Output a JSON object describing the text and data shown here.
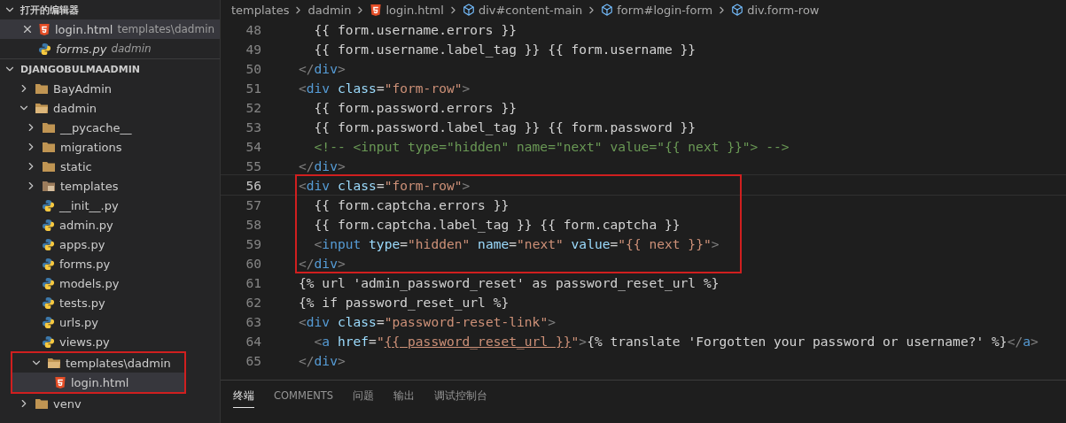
{
  "sidebar": {
    "open_editors": {
      "title": "打开的编辑器",
      "expanded": true,
      "items": [
        {
          "name": "login.html",
          "description": "templates\\dadmin",
          "kind": "html",
          "active": true,
          "preview": false
        },
        {
          "name": "forms.py",
          "description": "dadmin",
          "kind": "python",
          "active": false,
          "preview": true
        }
      ]
    },
    "project": {
      "title": "DJANGOBULMAADMIN",
      "expanded": true,
      "children": [
        {
          "name": "BayAdmin",
          "kind": "folder",
          "expanded": false,
          "selected": false
        },
        {
          "name": "dadmin",
          "kind": "folder",
          "expanded": true,
          "selected": false,
          "children": [
            {
              "name": "__pycache__",
              "kind": "folder",
              "expanded": false,
              "selected": false
            },
            {
              "name": "migrations",
              "kind": "folder",
              "expanded": false,
              "selected": false
            },
            {
              "name": "static",
              "kind": "folder",
              "expanded": false,
              "selected": false
            },
            {
              "name": "templates",
              "kind": "templates-folder",
              "expanded": false,
              "selected": false
            },
            {
              "name": "__init__.py",
              "kind": "python",
              "selected": false
            },
            {
              "name": "admin.py",
              "kind": "python",
              "selected": false
            },
            {
              "name": "apps.py",
              "kind": "python",
              "selected": false
            },
            {
              "name": "forms.py",
              "kind": "python",
              "selected": false
            },
            {
              "name": "models.py",
              "kind": "python",
              "selected": false
            },
            {
              "name": "tests.py",
              "kind": "python",
              "selected": false
            },
            {
              "name": "urls.py",
              "kind": "python",
              "selected": false
            },
            {
              "name": "views.py",
              "kind": "python",
              "selected": false
            }
          ]
        },
        {
          "name": "templates\\dadmin",
          "kind": "folder",
          "expanded": true,
          "selected": false,
          "highlighted": true,
          "children": [
            {
              "name": "login.html",
              "kind": "html",
              "selected": true
            }
          ]
        },
        {
          "name": "venv",
          "kind": "folder",
          "expanded": false,
          "selected": false
        }
      ]
    }
  },
  "breadcrumb": [
    {
      "text": "templates",
      "kind": "folder"
    },
    {
      "text": "dadmin",
      "kind": "folder"
    },
    {
      "text": "login.html",
      "kind": "html"
    },
    {
      "text": "div#content-main",
      "kind": "element"
    },
    {
      "text": "form#login-form",
      "kind": "element"
    },
    {
      "text": "div.form-row",
      "kind": "element"
    }
  ],
  "editor": {
    "lines": [
      {
        "number": "48",
        "current": false,
        "highlighted": false,
        "tokens": [
          {
            "kind": "text",
            "text": "  {{ form.username.errors }}"
          }
        ]
      },
      {
        "number": "49",
        "current": false,
        "highlighted": false,
        "tokens": [
          {
            "kind": "text",
            "text": "  {{ form.username.label_tag }} {{ form.username }}"
          }
        ]
      },
      {
        "number": "50",
        "current": false,
        "highlighted": false,
        "tokens": [
          {
            "kind": "punct",
            "text": "</"
          },
          {
            "kind": "tag",
            "text": "div"
          },
          {
            "kind": "punct",
            "text": ">"
          }
        ]
      },
      {
        "number": "51",
        "current": false,
        "highlighted": false,
        "tokens": [
          {
            "kind": "punct",
            "text": "<"
          },
          {
            "kind": "tag",
            "text": "div"
          },
          {
            "kind": "attr",
            "text": " class"
          },
          {
            "kind": "text",
            "text": "="
          },
          {
            "kind": "str",
            "text": "\"form-row\""
          },
          {
            "kind": "punct",
            "text": ">"
          }
        ]
      },
      {
        "number": "52",
        "current": false,
        "highlighted": false,
        "tokens": [
          {
            "kind": "text",
            "text": "  {{ form.password.errors }}"
          }
        ]
      },
      {
        "number": "53",
        "current": false,
        "highlighted": false,
        "tokens": [
          {
            "kind": "text",
            "text": "  {{ form.password.label_tag }} {{ form.password }}"
          }
        ]
      },
      {
        "number": "54",
        "current": false,
        "highlighted": false,
        "tokens": [
          {
            "kind": "comment",
            "text": "  <!-- <input type=\"hidden\" name=\"next\" value=\"{{ next }}\"> -->"
          }
        ]
      },
      {
        "number": "55",
        "current": false,
        "highlighted": false,
        "tokens": [
          {
            "kind": "punct",
            "text": "</"
          },
          {
            "kind": "tag",
            "text": "div"
          },
          {
            "kind": "punct",
            "text": ">"
          }
        ]
      },
      {
        "number": "56",
        "current": true,
        "highlighted": true,
        "tokens": [
          {
            "kind": "punct",
            "text": "<"
          },
          {
            "kind": "tag",
            "text": "div"
          },
          {
            "kind": "attr",
            "text": " class"
          },
          {
            "kind": "text",
            "text": "="
          },
          {
            "kind": "str",
            "text": "\"form-row\""
          },
          {
            "kind": "punct",
            "text": ">"
          }
        ]
      },
      {
        "number": "57",
        "current": false,
        "highlighted": true,
        "tokens": [
          {
            "kind": "text",
            "text": "  {{ form.captcha.errors }}"
          }
        ]
      },
      {
        "number": "58",
        "current": false,
        "highlighted": true,
        "tokens": [
          {
            "kind": "text",
            "text": "  {{ form.captcha.label_tag }} {{ form.captcha }}"
          }
        ]
      },
      {
        "number": "59",
        "current": false,
        "highlighted": true,
        "tokens": [
          {
            "kind": "punct",
            "text": "  <"
          },
          {
            "kind": "tag",
            "text": "input"
          },
          {
            "kind": "attr",
            "text": " type"
          },
          {
            "kind": "text",
            "text": "="
          },
          {
            "kind": "str",
            "text": "\"hidden\""
          },
          {
            "kind": "attr",
            "text": " name"
          },
          {
            "kind": "text",
            "text": "="
          },
          {
            "kind": "str",
            "text": "\"next\""
          },
          {
            "kind": "attr",
            "text": " value"
          },
          {
            "kind": "text",
            "text": "="
          },
          {
            "kind": "str",
            "text": "\"{{ next }}\""
          },
          {
            "kind": "punct",
            "text": ">"
          }
        ]
      },
      {
        "number": "60",
        "current": false,
        "highlighted": true,
        "tokens": [
          {
            "kind": "punct",
            "text": "</"
          },
          {
            "kind": "tag",
            "text": "div"
          },
          {
            "kind": "punct",
            "text": ">"
          }
        ]
      },
      {
        "number": "61",
        "current": false,
        "highlighted": false,
        "tokens": [
          {
            "kind": "text",
            "text": "{% url 'admin_password_reset' as password_reset_url %}"
          }
        ]
      },
      {
        "number": "62",
        "current": false,
        "highlighted": false,
        "tokens": [
          {
            "kind": "text",
            "text": "{% if password_reset_url %}"
          }
        ]
      },
      {
        "number": "63",
        "current": false,
        "highlighted": false,
        "tokens": [
          {
            "kind": "punct",
            "text": "<"
          },
          {
            "kind": "tag",
            "text": "div"
          },
          {
            "kind": "attr",
            "text": " class"
          },
          {
            "kind": "text",
            "text": "="
          },
          {
            "kind": "str",
            "text": "\"password-reset-link\""
          },
          {
            "kind": "punct",
            "text": ">"
          }
        ]
      },
      {
        "number": "64",
        "current": false,
        "highlighted": false,
        "tokens": [
          {
            "kind": "punct",
            "text": "  <"
          },
          {
            "kind": "tag",
            "text": "a"
          },
          {
            "kind": "attr",
            "text": " href"
          },
          {
            "kind": "text",
            "text": "="
          },
          {
            "kind": "str",
            "text": "\""
          },
          {
            "kind": "link",
            "text": "{{ password_reset_url }}"
          },
          {
            "kind": "str",
            "text": "\""
          },
          {
            "kind": "punct",
            "text": ">"
          },
          {
            "kind": "text",
            "text": "{% translate 'Forgotten your password or username?' %}"
          },
          {
            "kind": "punct",
            "text": "</"
          },
          {
            "kind": "tag",
            "text": "a"
          },
          {
            "kind": "punct",
            "text": ">"
          }
        ]
      },
      {
        "number": "65",
        "current": false,
        "highlighted": false,
        "tokens": [
          {
            "kind": "punct",
            "text": "</"
          },
          {
            "kind": "tag",
            "text": "div"
          },
          {
            "kind": "punct",
            "text": ">"
          }
        ]
      }
    ]
  },
  "panel": {
    "tabs": [
      {
        "label": "终端",
        "selected": true
      },
      {
        "label": "COMMENTS",
        "selected": false
      },
      {
        "label": "问题",
        "selected": false
      },
      {
        "label": "输出",
        "selected": false
      },
      {
        "label": "调试控制台",
        "selected": false
      }
    ]
  }
}
